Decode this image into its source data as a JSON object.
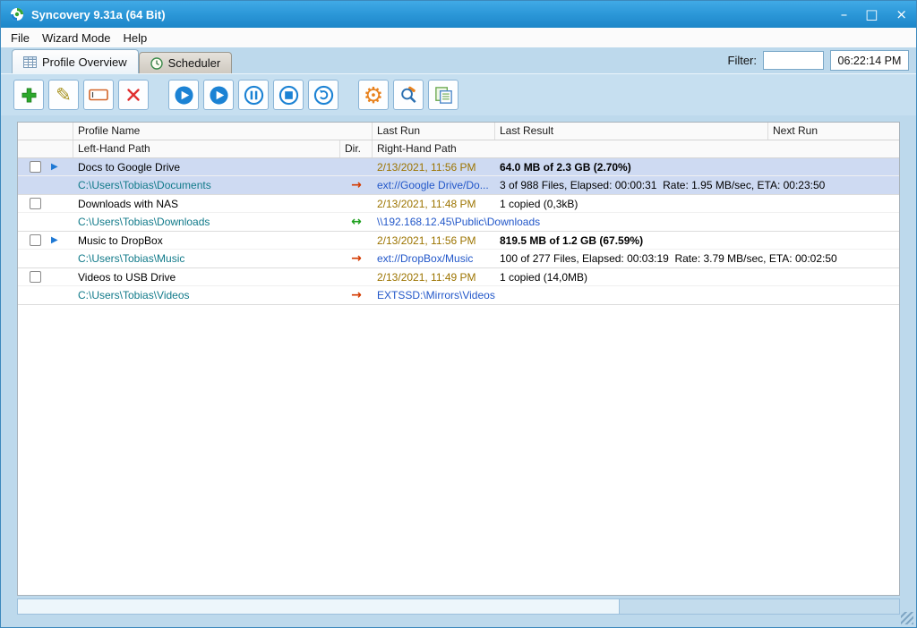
{
  "window": {
    "title": "Syncovery 9.31a (64 Bit)",
    "controls": {
      "minimize": "–",
      "maximize": "□",
      "close": "×"
    }
  },
  "menu": {
    "file": "File",
    "wizard_mode": "Wizard Mode",
    "help": "Help"
  },
  "tabs": {
    "profile_overview": "Profile Overview",
    "scheduler": "Scheduler"
  },
  "filter": {
    "label": "Filter:",
    "value": ""
  },
  "clock": {
    "time": "06:22:14 PM"
  },
  "toolbar": {
    "buttons": [
      "add-profile-icon",
      "edit-profile-icon",
      "rename-profile-icon",
      "delete-profile-icon",
      "run-profile-icon",
      "run-attended-icon",
      "pause-icon",
      "stop-icon",
      "restart-icon",
      "settings-gear-icon",
      "find-tools-icon",
      "copy-profiles-icon"
    ]
  },
  "colors": {
    "titlebar_blue": "#2b97d8",
    "selected_row": "#cedaf2",
    "left_path_link": "#117a8a",
    "right_path_link": "#2257c9",
    "last_run_text": "#9c7400",
    "arrow_red": "#d43a00",
    "arrow_green": "#1fa01f"
  },
  "table": {
    "header_row1": {
      "profile_name": "Profile Name",
      "last_run": "Last Run",
      "last_result": "Last Result",
      "next_run": "Next Run"
    },
    "header_row2": {
      "left_path": "Left-Hand Path",
      "dir": "Dir.",
      "right_path": "Right-Hand Path"
    },
    "rows": [
      {
        "run_indicator": "▶",
        "name": "Docs to Google Drive",
        "left_path": "C:\\Users\\Tobias\\Documents",
        "dir": "→",
        "right_path": "ext://Google Drive/Do...",
        "last_run": "2/13/2021, 11:56 PM",
        "result": "64.0 MB of 2.3 GB (2.70%)",
        "detail": "3 of 988 Files, Elapsed: 00:00:31  Rate: 1.95 MB/sec, ETA: 00:23:50",
        "next_run": ""
      },
      {
        "run_indicator": "",
        "name": "Downloads with NAS",
        "left_path": "C:\\Users\\Tobias\\Downloads",
        "dir": "↔",
        "right_path": "\\\\192.168.12.45\\Public\\Downloads",
        "last_run": "2/13/2021, 11:48 PM",
        "result": "1 copied (0,3kB)",
        "detail": "",
        "next_run": ""
      },
      {
        "run_indicator": "▶",
        "name": "Music to DropBox",
        "left_path": "C:\\Users\\Tobias\\Music",
        "dir": "→",
        "right_path": "ext://DropBox/Music",
        "last_run": "2/13/2021, 11:56 PM",
        "result": "819.5 MB of 1.2 GB (67.59%)",
        "detail": "100 of 277 Files, Elapsed: 00:03:19  Rate: 3.79 MB/sec, ETA: 00:02:50",
        "next_run": ""
      },
      {
        "run_indicator": "",
        "name": "Videos to USB Drive",
        "left_path": "C:\\Users\\Tobias\\Videos",
        "dir": "→",
        "right_path": "EXTSSD:\\Mirrors\\Videos",
        "last_run": "2/13/2021, 11:49 PM",
        "result": "1 copied (14,0MB)",
        "detail": "",
        "next_run": ""
      }
    ]
  }
}
